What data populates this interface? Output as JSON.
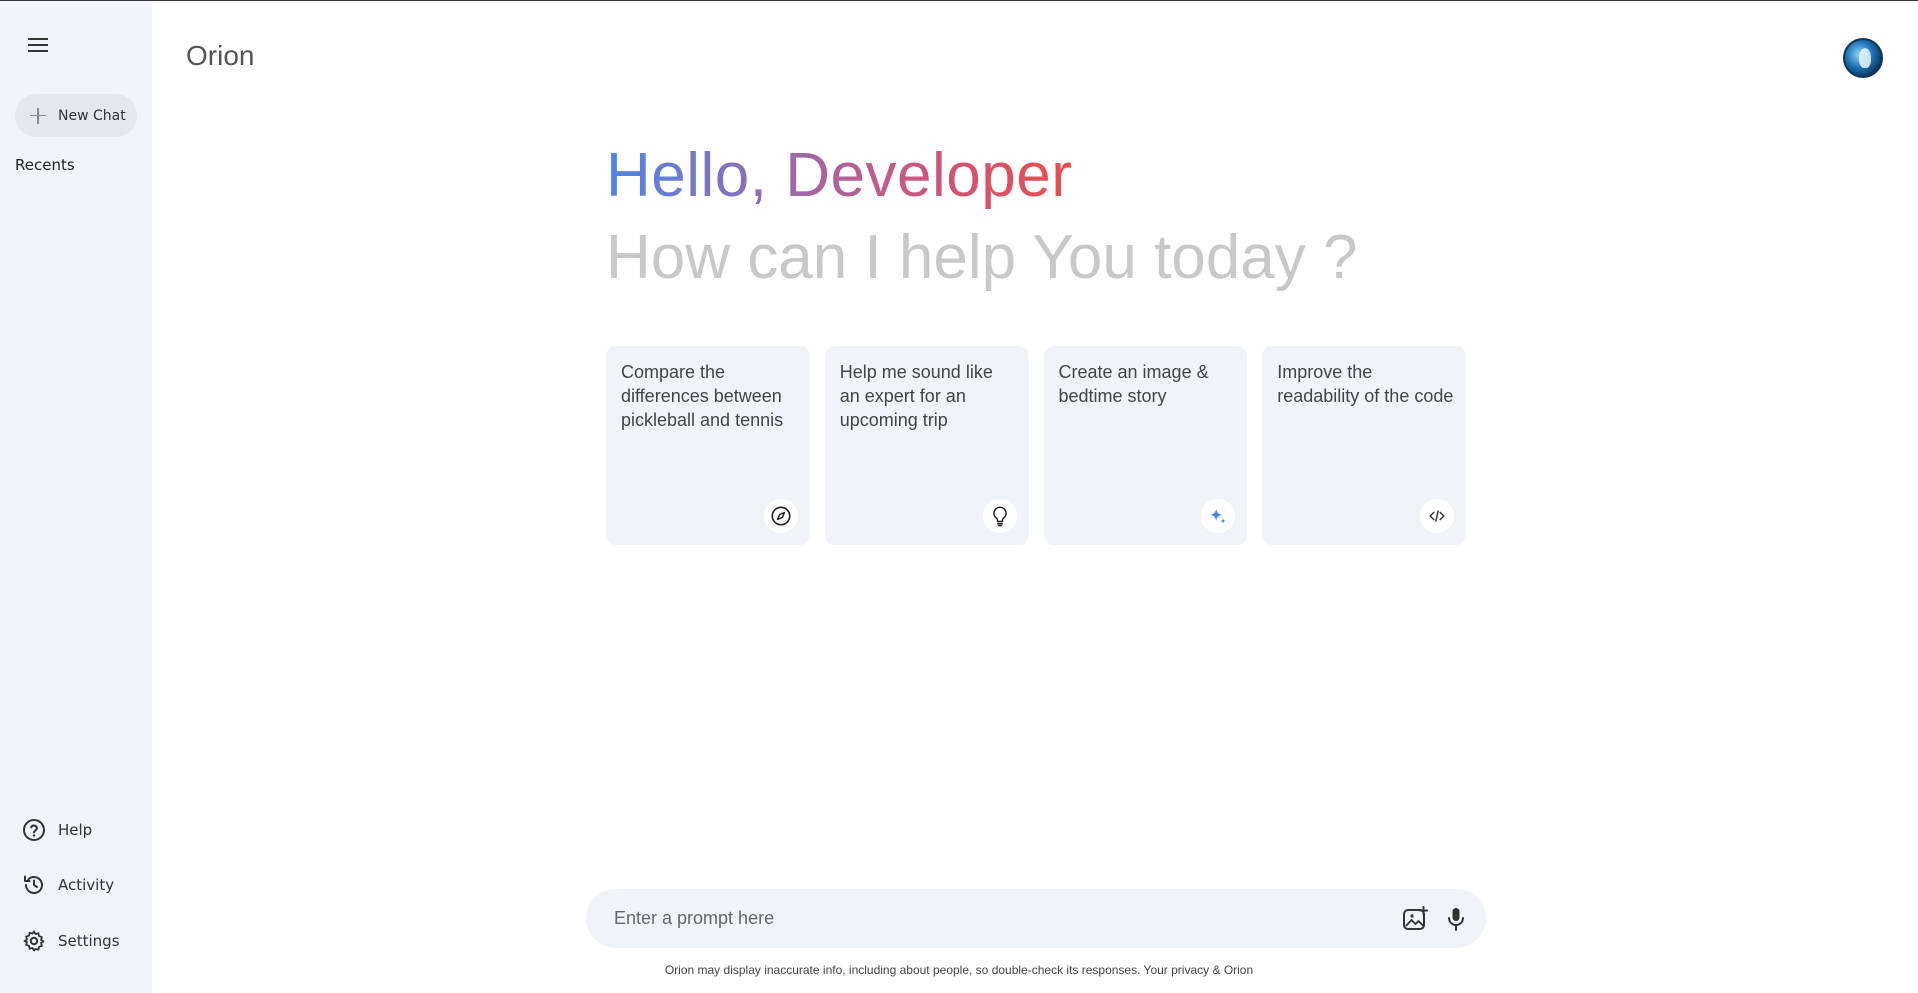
{
  "app": {
    "title": "Orion"
  },
  "sidebar": {
    "new_chat_label": "New Chat",
    "recents_label": "Recents",
    "bottom_items": [
      {
        "label": "Help",
        "icon": "help-icon"
      },
      {
        "label": "Activity",
        "icon": "history-icon"
      },
      {
        "label": "Settings",
        "icon": "gear-icon"
      }
    ]
  },
  "main": {
    "greeting": "Hello, Developer",
    "subtitle": "How can I help You today ?",
    "cards": [
      {
        "text": "Compare the differences between pickleball and tennis",
        "icon": "compass-icon"
      },
      {
        "text": "Help me sound like an expert for an upcoming trip",
        "icon": "lightbulb-icon"
      },
      {
        "text": "Create an image & bedtime story",
        "icon": "sparkle-icon"
      },
      {
        "text": "Improve the readability of the code",
        "icon": "code-icon"
      }
    ]
  },
  "prompt": {
    "placeholder": "Enter a prompt here",
    "value": ""
  },
  "footer": {
    "disclaimer": "Orion may display inaccurate info, including about people, so double-check its responses. Your privacy & Orion"
  },
  "colors": {
    "sidebar_bg": "#f0f3f8",
    "card_bg": "#f0f3f8",
    "greeting_gradient_start": "#4c86e8",
    "greeting_gradient_end": "#ea4b4b",
    "subtitle": "#c8c8c8",
    "sparkle_accent": "#4c86e8"
  }
}
